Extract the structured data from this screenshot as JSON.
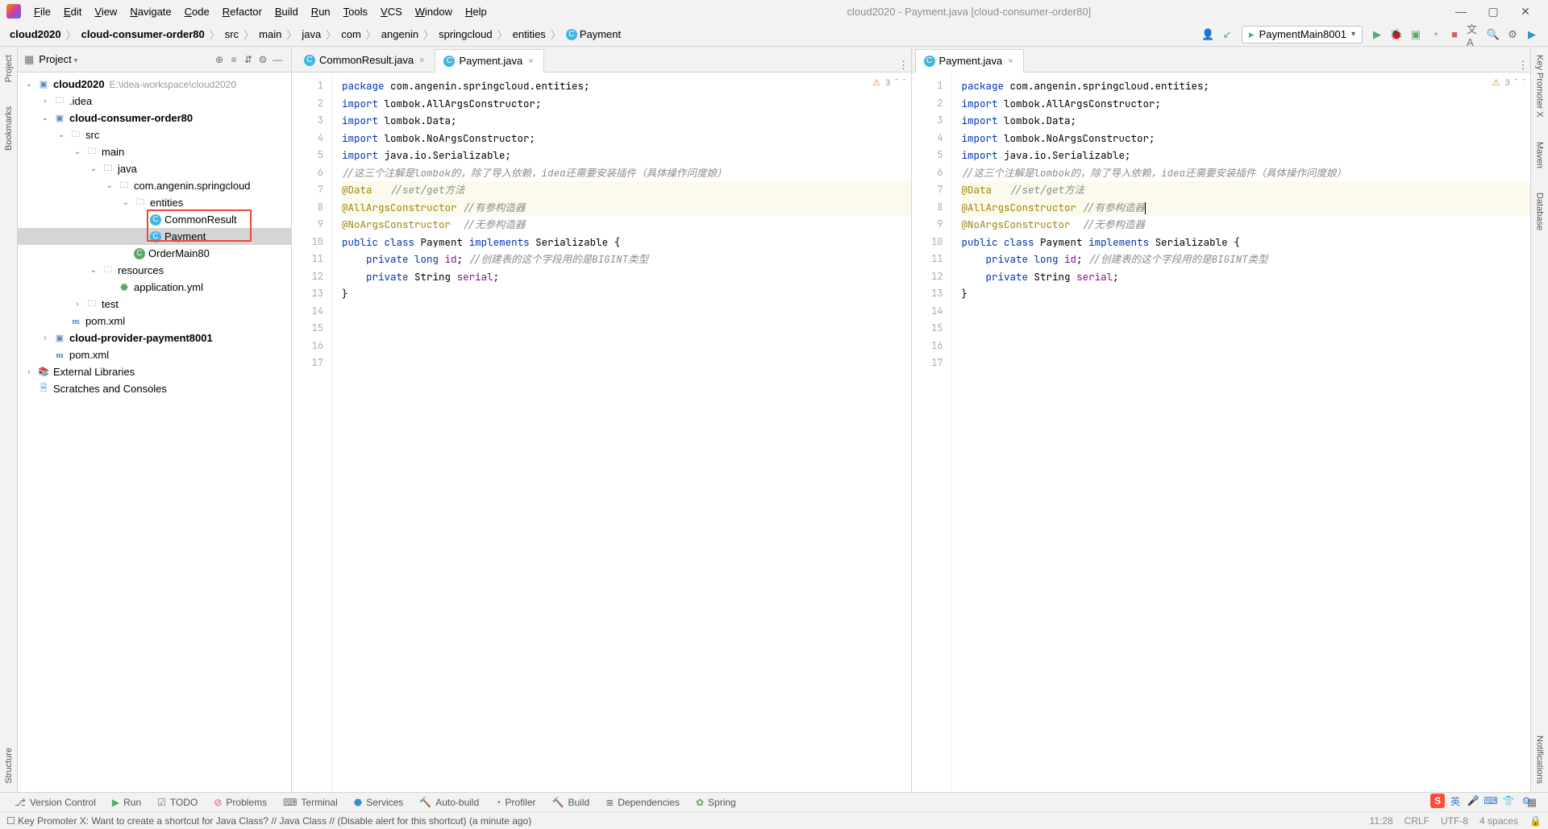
{
  "window_title": "cloud2020 - Payment.java [cloud-consumer-order80]",
  "menus": [
    "File",
    "Edit",
    "View",
    "Navigate",
    "Code",
    "Refactor",
    "Build",
    "Run",
    "Tools",
    "VCS",
    "Window",
    "Help"
  ],
  "breadcrumbs": [
    "cloud2020",
    "cloud-consumer-order80",
    "src",
    "main",
    "java",
    "com",
    "angenin",
    "springcloud",
    "entities",
    "Payment"
  ],
  "run_config": "PaymentMain8001",
  "project_panel_title": "Project",
  "tree": {
    "root": "cloud2020",
    "root_path": "E:\\idea-workspace\\cloud2020",
    "idea": ".idea",
    "module1": "cloud-consumer-order80",
    "src": "src",
    "main": "main",
    "java": "java",
    "pkg": "com.angenin.springcloud",
    "entities": "entities",
    "commonResult": "CommonResult",
    "payment": "Payment",
    "orderMain": "OrderMain80",
    "resources": "resources",
    "appyml": "application.yml",
    "test": "test",
    "pom": "pom.xml",
    "module2": "cloud-provider-payment8001",
    "pom2": "pom.xml",
    "ext": "External Libraries",
    "scratches": "Scratches and Consoles"
  },
  "tabs_left": [
    {
      "name": "CommonResult.java",
      "active": false
    },
    {
      "name": "Payment.java",
      "active": true
    }
  ],
  "tabs_right": [
    {
      "name": "Payment.java",
      "active": true
    }
  ],
  "inspection_count": "3",
  "code_lines": [
    {
      "n": 1,
      "html": "<span class='kw'>package</span> com.angenin.springcloud.entities;"
    },
    {
      "n": 2,
      "html": ""
    },
    {
      "n": 3,
      "html": "<span class='kw'>import</span> lombok.<span class='typ'>AllArgsConstructor</span>;"
    },
    {
      "n": 4,
      "html": "<span class='kw'>import</span> lombok.<span class='typ'>Data</span>;"
    },
    {
      "n": 5,
      "html": "<span class='kw'>import</span> lombok.<span class='typ'>NoArgsConstructor</span>;"
    },
    {
      "n": 6,
      "html": ""
    },
    {
      "n": 7,
      "html": "<span class='kw'>import</span> java.io.<span class='typ'>Serializable</span>;"
    },
    {
      "n": 8,
      "html": ""
    },
    {
      "n": 9,
      "html": "<span class='cmt'>//这三个注解是lombok的，除了导入依赖，idea还需要安装插件（具体操作问度娘）</span>",
      "diff": true
    },
    {
      "n": 10,
      "html": "<span class='ann'>@Data</span>   <span class='cmt'>//set/get方法</span>",
      "hl": true,
      "diff": true
    },
    {
      "n": 11,
      "html": "<span class='ann'>@AllArgsConstructor</span> <span class='cmt'>//有参构造器</span>",
      "hl": true,
      "diff": true
    },
    {
      "n": 12,
      "html": "<span class='ann'>@NoArgsConstructor</span>  <span class='cmt'>//无参构造器</span>",
      "diff": true
    },
    {
      "n": 13,
      "html": "<span class='kw'>public class</span> <span class='typ'>Payment</span> <span class='kw'>implements</span> <span class='typ'>Serializable</span> {",
      "diff": true
    },
    {
      "n": 14,
      "html": "    <span class='kw'>private long</span> <span class='fld'>id</span>; <span class='cmt'>//创建表的这个字段用的是BIGINT类型</span>",
      "diff": true
    },
    {
      "n": 15,
      "html": "    <span class='kw'>private</span> <span class='typ'>String</span> <span class='fld'>serial</span>;"
    },
    {
      "n": 16,
      "html": "}"
    },
    {
      "n": 17,
      "html": ""
    }
  ],
  "bottom_tools": [
    "Version Control",
    "Run",
    "TODO",
    "Problems",
    "Terminal",
    "Services",
    "Auto-build",
    "Profiler",
    "Build",
    "Dependencies",
    "Spring"
  ],
  "status_msg": "Key Promoter X: Want to create a shortcut for Java Class? // Java Class // (Disable alert for this shortcut) (a minute ago)",
  "status_right": {
    "pos": "11:28",
    "sep": "CRLF",
    "enc": "UTF-8",
    "indent": "4 spaces"
  },
  "side_left": [
    "Project",
    "Bookmarks",
    "Structure"
  ],
  "side_right": [
    "Key Promoter X",
    "Maven",
    "Database",
    "Notifications"
  ]
}
